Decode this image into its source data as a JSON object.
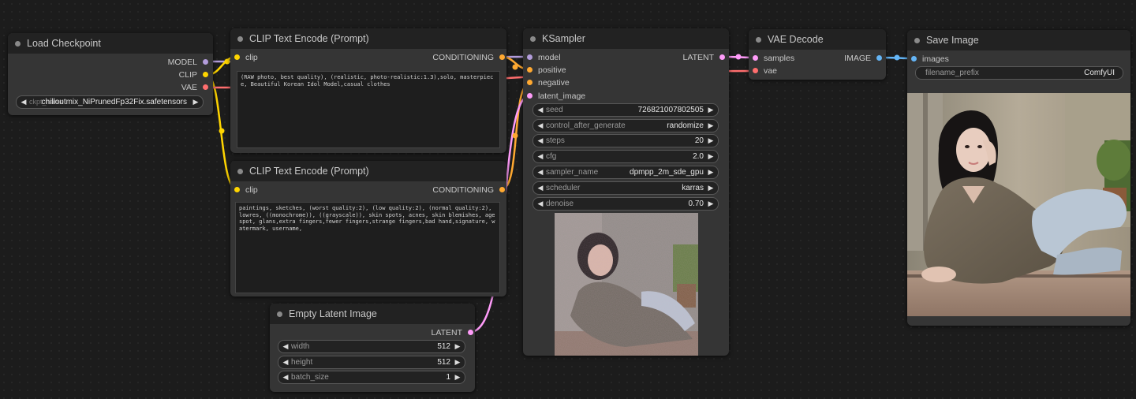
{
  "colors": {
    "model": "#b39ddb",
    "clip": "#ffd500",
    "vae": "#ff6e6e",
    "conditioning": "#ffa931",
    "latent": "#ff9cf9",
    "image": "#64b5f6"
  },
  "load_checkpoint": {
    "title": "Load Checkpoint",
    "outputs": [
      "MODEL",
      "CLIP",
      "VAE"
    ],
    "ckpt_label": "ckpt_name",
    "ckpt_value": "chilloutmix_NiPrunedFp32Fix.safetensors"
  },
  "clip_pos": {
    "title": "CLIP Text Encode (Prompt)",
    "input": "clip",
    "output": "CONDITIONING",
    "text": "(RAW photo, best quality), (realistic, photo-realistic:1.3),solo, masterpiece, Beautiful Korean Idol Model,casual clothes"
  },
  "clip_neg": {
    "title": "CLIP Text Encode (Prompt)",
    "input": "clip",
    "output": "CONDITIONING",
    "text": "paintings, sketches, (worst quality:2), (low quality:2), (normal quality:2), lowres, ((monochrome)), ((grayscale)), skin spots, acnes, skin blemishes, age spot, glans,extra fingers,fewer fingers,strange fingers,bad hand,signature, watermark, username,"
  },
  "empty_latent": {
    "title": "Empty Latent Image",
    "output": "LATENT",
    "widgets": [
      {
        "label": "width",
        "value": "512"
      },
      {
        "label": "height",
        "value": "512"
      },
      {
        "label": "batch_size",
        "value": "1"
      }
    ]
  },
  "ksampler": {
    "title": "KSampler",
    "inputs": [
      "model",
      "positive",
      "negative",
      "latent_image"
    ],
    "output": "LATENT",
    "widgets": [
      {
        "label": "seed",
        "value": "726821007802505"
      },
      {
        "label": "control_after_generate",
        "value": "randomize"
      },
      {
        "label": "steps",
        "value": "20"
      },
      {
        "label": "cfg",
        "value": "2.0"
      },
      {
        "label": "sampler_name",
        "value": "dpmpp_2m_sde_gpu"
      },
      {
        "label": "scheduler",
        "value": "karras"
      },
      {
        "label": "denoise",
        "value": "0.70"
      }
    ]
  },
  "vae_decode": {
    "title": "VAE Decode",
    "inputs": [
      "samples",
      "vae"
    ],
    "output": "IMAGE"
  },
  "save_image": {
    "title": "Save Image",
    "input": "images",
    "prefix_label": "filename_prefix",
    "prefix_value": "ComfyUI"
  }
}
